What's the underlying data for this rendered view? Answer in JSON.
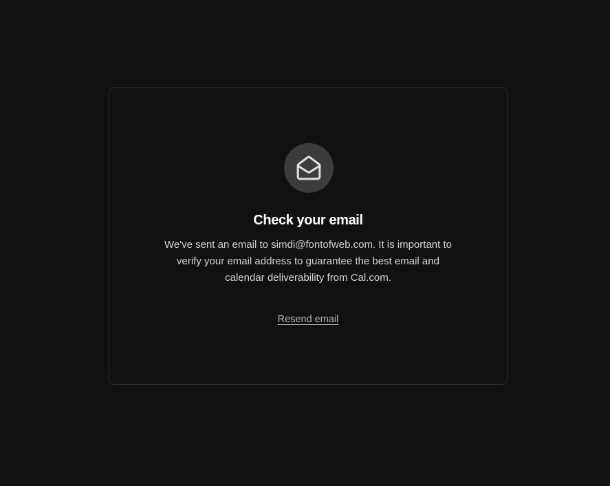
{
  "verify": {
    "icon": "mail-open-icon",
    "title": "Check your email",
    "message": "We've sent an email to simdi@fontofweb.com. It is important to verify your email address to guarantee the best email and calendar deliverability from Cal.com.",
    "resend_label": "Resend email"
  },
  "colors": {
    "background": "#111111",
    "card_border": "#2e2e2e",
    "icon_circle": "#3c3c3c",
    "title": "#ffffff",
    "body_text": "#d4d4d4",
    "link": "#b0b0b0"
  }
}
